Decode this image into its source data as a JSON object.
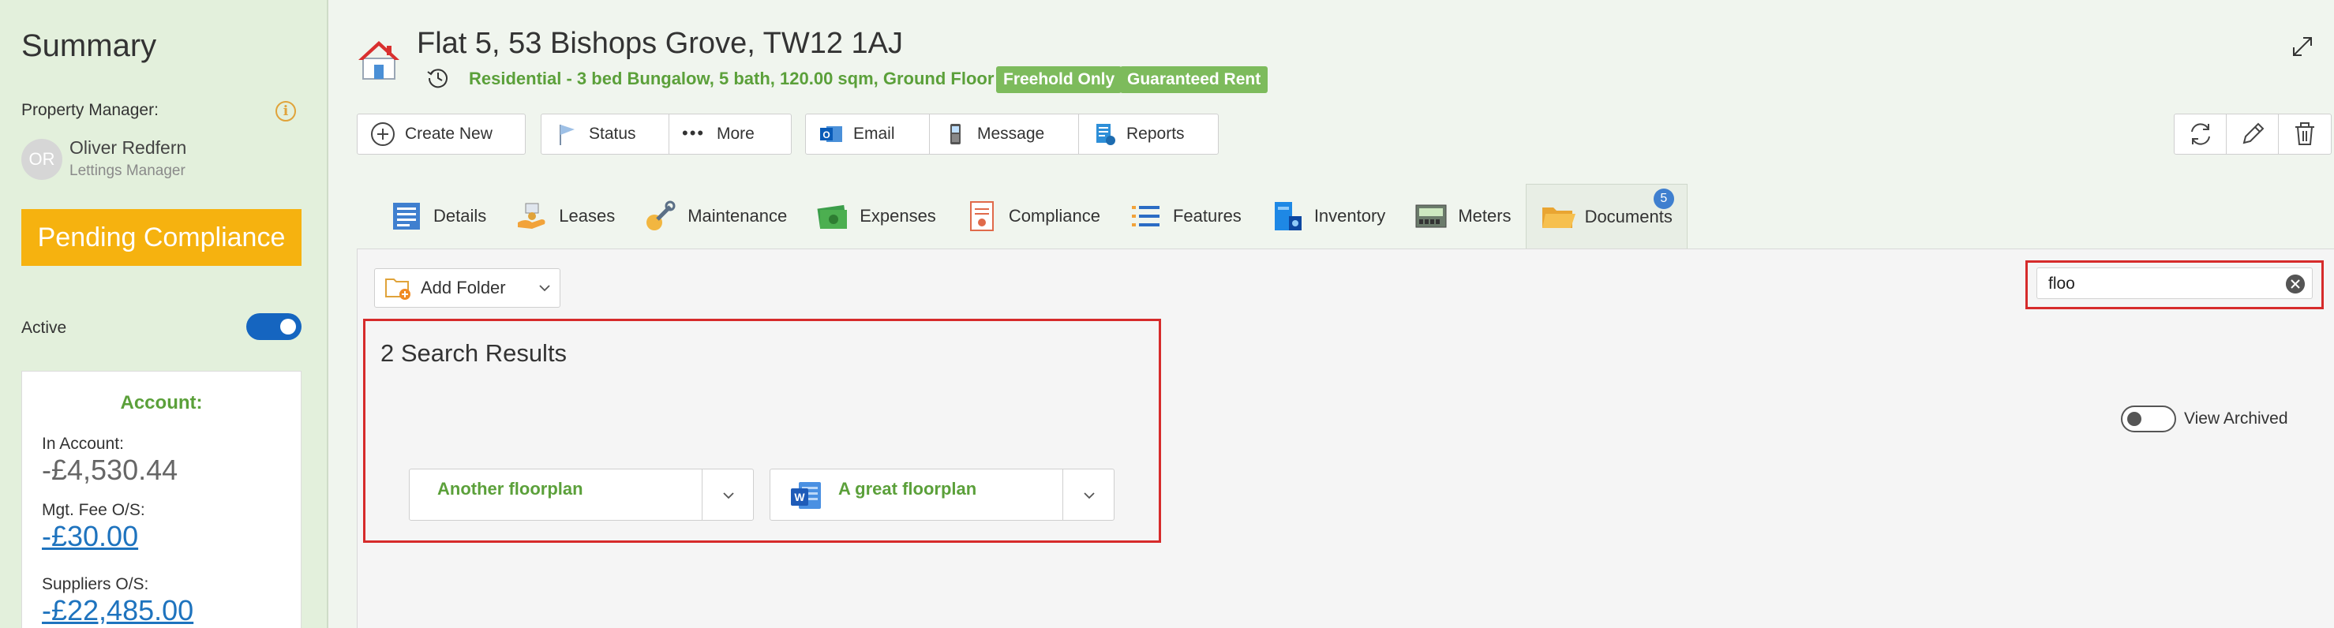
{
  "sidebar": {
    "title": "Summary",
    "pm_label": "Property Manager:",
    "pm_initials": "OR",
    "pm_name": "Oliver Redfern",
    "pm_role": "Lettings Manager",
    "status_label": "Pending Compliance",
    "active_label": "Active",
    "active": true,
    "account": {
      "title": "Account:",
      "in_account_label": "In Account:",
      "in_account_value": "-£4,530.44",
      "mgt_fee_label": "Mgt. Fee O/S:",
      "mgt_fee_value": "-£30.00",
      "suppliers_label": "Suppliers O/S:",
      "suppliers_value": "-£22,485.00"
    }
  },
  "header": {
    "title": "Flat 5,  53 Bishops Grove, TW12 1AJ",
    "description": "Residential - 3 bed Bungalow, 5 bath, 120.00 sqm, Ground Floor",
    "badges": [
      "Freehold Only",
      "Guaranteed Rent"
    ]
  },
  "toolbar": {
    "create_new": "Create New",
    "status": "Status",
    "more": "More",
    "email": "Email",
    "message": "Message",
    "reports": "Reports"
  },
  "tabs": [
    {
      "label": "Details",
      "icon": "details-icon"
    },
    {
      "label": "Leases",
      "icon": "leases-icon"
    },
    {
      "label": "Maintenance",
      "icon": "maintenance-icon"
    },
    {
      "label": "Expenses",
      "icon": "expenses-icon"
    },
    {
      "label": "Compliance",
      "icon": "compliance-icon"
    },
    {
      "label": "Features",
      "icon": "features-icon"
    },
    {
      "label": "Inventory",
      "icon": "inventory-icon"
    },
    {
      "label": "Meters",
      "icon": "meters-icon"
    },
    {
      "label": "Documents",
      "icon": "documents-icon",
      "badge": "5",
      "active": true
    }
  ],
  "documents": {
    "add_folder": "Add Folder",
    "search_value": "floo",
    "results_title": "2 Search Results",
    "view_archived_label": "View Archived",
    "view_archived": false,
    "results": [
      {
        "name": "Another floorplan"
      },
      {
        "name": "A great floorplan",
        "icon": "word-icon"
      }
    ]
  }
}
